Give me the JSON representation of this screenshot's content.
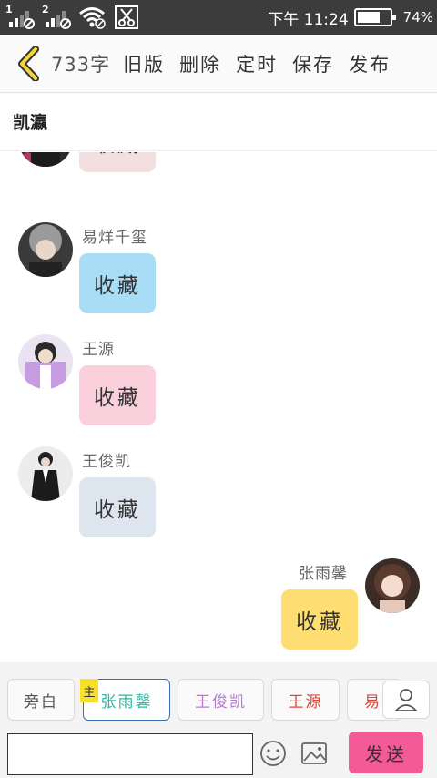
{
  "status_bar": {
    "sim1": "1",
    "sim2": "2",
    "time": "下午 11:24",
    "battery_percent": "74%",
    "battery_level": 0.74
  },
  "toolbar": {
    "word_count": "733字",
    "actions": [
      "旧版",
      "删除",
      "定时",
      "保存",
      "发布"
    ]
  },
  "title": "凯瀛",
  "messages": [
    {
      "sender": "",
      "text": "收藏",
      "side": "left",
      "bubble_color": "#f3dfdf",
      "avatar": "dark-red"
    },
    {
      "sender": "易烊千玺",
      "text": "收藏",
      "side": "left",
      "bubble_color": "#a9dcf5",
      "avatar": "silver-hair"
    },
    {
      "sender": "王源",
      "text": "收藏",
      "side": "left",
      "bubble_color": "#fad0dc",
      "avatar": "purple-jacket"
    },
    {
      "sender": "王俊凯",
      "text": "收藏",
      "side": "left",
      "bubble_color": "#dde5ee",
      "avatar": "black-suit"
    },
    {
      "sender": "张雨馨",
      "text": "收藏",
      "side": "right",
      "bubble_color": "#fede72",
      "avatar": "girl"
    }
  ],
  "roles": [
    {
      "label": "旁白",
      "color": "#555555"
    },
    {
      "label": "张雨馨",
      "color": "#2fb6a8"
    },
    {
      "label": "王俊凯",
      "color": "#b77ad0"
    },
    {
      "label": "王源",
      "color": "#e0453a"
    },
    {
      "label": "易",
      "color": "#e0453a"
    }
  ],
  "main_badge": "主",
  "input": {
    "value": "",
    "placeholder": ""
  },
  "send_label": "发送",
  "colors": {
    "send_button": "#f45a95",
    "status_bar": "#3c3c3c",
    "back_arrow": "#f2d63a"
  }
}
